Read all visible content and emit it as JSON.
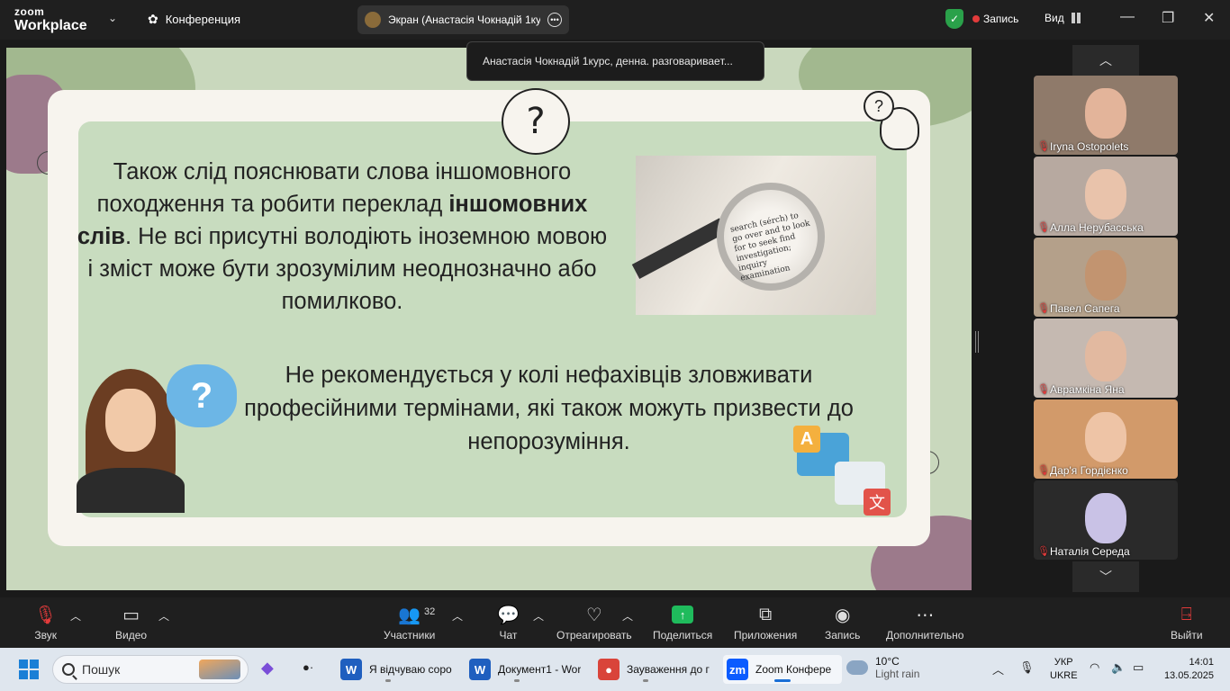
{
  "app": {
    "brand_top": "zoom",
    "brand_bottom": "Workplace",
    "meeting_label": "Конференция",
    "screen_tab": "Экран (Анастасія Чокнадій 1курс",
    "record_label": "Запись",
    "view_label": "Вид",
    "tooltip": "Анастасія Чокнадій 1курс, денна. разговариваeт..."
  },
  "slide": {
    "para1_pre": "Також слід пояснювати слова іншомовного походження та робити переклад",
    "para1_bold": "іншомовних слів",
    "para1_post": ". Не всі присутні володіють іноземною мовою і зміст може бути зрозумілим неоднозначно або помилково.",
    "para2": "Не рекомендується у колі нефахівців зловживати професійними термінами, які також можуть призвести до непорозуміння.",
    "photo_text": "search (sérch) to go over and to look for to seek find investigation; inquiry examination",
    "q_symbol": "?",
    "trans_a": "A",
    "trans_b": "文"
  },
  "participants": [
    {
      "name": "Iryna Ostopolets",
      "color": "#8f7a6a",
      "face": "#e3b49a"
    },
    {
      "name": "Алла Нерубасська",
      "color": "#b7a9a0",
      "face": "#e9c3ab"
    },
    {
      "name": "Павел Сапега",
      "color": "#b4a08a",
      "face": "#c29470"
    },
    {
      "name": "Аврамкіна Яна",
      "color": "#c5b9b1",
      "face": "#e2b9a0"
    },
    {
      "name": "Дар'я Гордієнко",
      "color": "#d29a6a",
      "face": "#eec4a6"
    },
    {
      "name": "Наталія Середа",
      "color": "#2a2a2a",
      "face": "#c9c2e6"
    }
  ],
  "toolbar": {
    "audio": "Звук",
    "video": "Видео",
    "participants": "Участники",
    "participants_count": "32",
    "chat": "Чат",
    "react": "Отреагировать",
    "share": "Поделиться",
    "apps": "Приложения",
    "record": "Запись",
    "more": "Дополнительно",
    "leave": "Выйти"
  },
  "taskbar": {
    "search": "Пошук",
    "apps": [
      {
        "label": "Я відчуваю соро",
        "icon": "W",
        "color": "#1f5fbf"
      },
      {
        "label": "Документ1 - Wor",
        "icon": "W",
        "color": "#1f5fbf"
      },
      {
        "label": "Зауваження до г",
        "icon": "●",
        "color": "#d9443a"
      },
      {
        "label": "Zoom Конфере",
        "icon": "zm",
        "color": "#0b5cff"
      }
    ],
    "weather_temp": "10°C",
    "weather_desc": "Light rain",
    "lang_1": "УКР",
    "lang_2": "UKRE",
    "time": "14:01",
    "date": "13.05.2025"
  }
}
